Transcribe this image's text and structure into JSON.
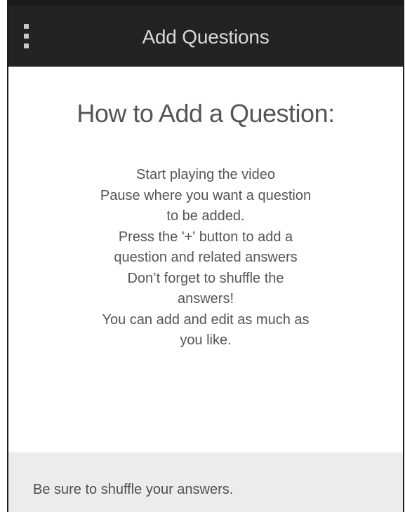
{
  "header": {
    "title": "Add Questions",
    "menu_icon": "vertical-ellipsis-icon"
  },
  "main": {
    "heading": "How to Add a Question:",
    "instructions": [
      "Start playing the video",
      "Pause where you want a question",
      "to be added.",
      "Press the '+' button to add a",
      "question and related answers",
      "Don’t forget to shuffle the",
      "answers!",
      "You can add and edit as much as",
      "you like."
    ]
  },
  "footer": {
    "note": "Be sure to shuffle your answers."
  },
  "colors": {
    "header_background": "#232323",
    "header_text": "#d8d8d8",
    "body_text": "#555555",
    "footer_background": "#ececec"
  }
}
